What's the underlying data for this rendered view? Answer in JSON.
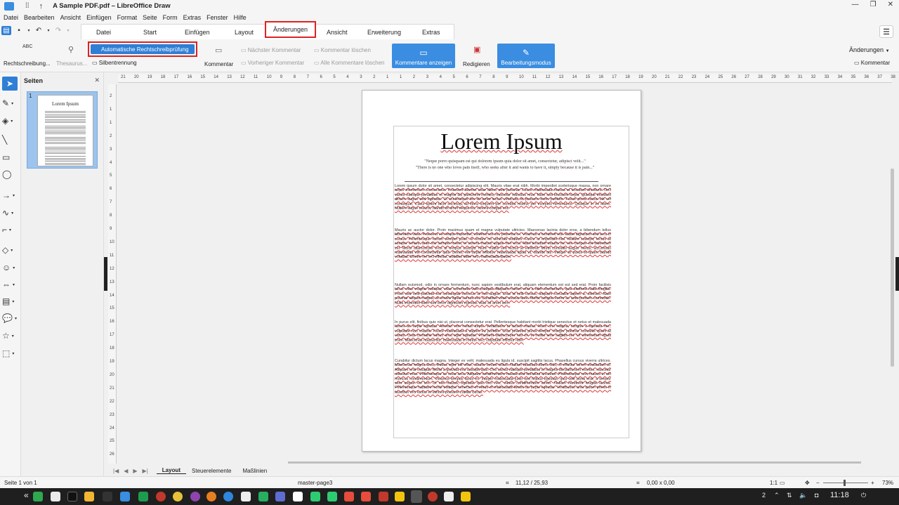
{
  "title": "A Sample PDF.pdf – LibreOffice Draw",
  "menu": [
    "Datei",
    "Bearbeiten",
    "Ansicht",
    "Einfügen",
    "Format",
    "Seite",
    "Form",
    "Extras",
    "Fenster",
    "Hilfe"
  ],
  "tabs": [
    "Datei",
    "Start",
    "Einfügen",
    "Layout",
    "Änderungen",
    "Ansicht",
    "Erweiterung",
    "Extras"
  ],
  "selected_tab": "Änderungen",
  "ribbon": {
    "spelling": "Rechtschreibung...",
    "thesaurus": "Thesaurus...",
    "auto_spell": "Automatische Rechtschreibprüfung",
    "hyphenation": "Silbentrennung",
    "comment": "Kommentar",
    "next_comment": "Nächster Kommentar",
    "prev_comment": "Vorheriger Kommentar",
    "delete_comment": "Kommentar löschen",
    "delete_all_comments": "Alle Kommentare löschen",
    "show_comments": "Kommentare anzeigen",
    "redact": "Redigieren",
    "edit_mode": "Bearbeitungsmodus",
    "changes_dropdown": "Änderungen",
    "right_comment": "Kommentar"
  },
  "pages_pane": {
    "title": "Seiten",
    "thumb_number": "1",
    "thumb_title": "Lorem Ipsum"
  },
  "ruler_h": [
    "21",
    "20",
    "19",
    "18",
    "17",
    "16",
    "15",
    "14",
    "13",
    "12",
    "11",
    "10",
    "9",
    "8",
    "7",
    "6",
    "5",
    "4",
    "3",
    "2",
    "1",
    "1",
    "2",
    "3",
    "4",
    "5",
    "6",
    "7",
    "8",
    "9",
    "10",
    "11",
    "12",
    "13",
    "14",
    "15",
    "16",
    "17",
    "18",
    "19",
    "20",
    "21",
    "22",
    "23",
    "24",
    "25",
    "26",
    "27",
    "28",
    "29",
    "30",
    "31",
    "32",
    "33",
    "34",
    "35",
    "36",
    "37",
    "38"
  ],
  "ruler_v": [
    "2",
    "1",
    "1",
    "2",
    "3",
    "4",
    "5",
    "6",
    "7",
    "8",
    "9",
    "10",
    "11",
    "12",
    "13",
    "14",
    "15",
    "16",
    "17",
    "18",
    "19",
    "20",
    "21",
    "22",
    "23",
    "24",
    "25",
    "26"
  ],
  "document": {
    "title": "Lorem Ipsum",
    "quote1": "\"Neque porro quisquam est qui dolorem ipsum quia dolor sit amet, consectetur, adipisci velit...\"",
    "quote2": "\"There is no one who loves pain itself, who seeks after it and wants to have it, simply because it is pain...\"",
    "paragraphs": [
      "Lorem ipsum dolor sit amet, consectetur adipiscing elit. Mauris vitae erat nibh. Morbi imperdiet scelerisque massa, non ornare turpis elementum consectetur. Praesent laoreet vitae libero sed pulvinar. Fusce malesuada massa et tincidunt tincidunt. Orci varius natoque penatibus et magnis dis parturient montes, nascetur ridiculus mus. Nam sed tincidunt turpis. Quisque tincidunt dictum augue sed egestas. Ut scelerisque leo sit amet lectus vehicula, et posuere enim porttitor. Fusce porta varius elit vel consequat. Class aptent taciti sociosqu ad litora torquent per conubia nostra, per inceptos himenaeos. Quisque in ex libero. Nullam augue mauris, blandit sit amet neque eu, viverra congue est.",
      "Mauris ac auctor dolor. Proin maximus quam et magna vulputate ultricies. Maecenas lacinia dolor eros, a bibendum tellus bibendum vitae. Praesent vel neque imperdiet, eleifend est vel, pharetra ex. Vivamus a hendrerit nisl. Etiam dignissim sed arcu in cursus. Pellentesque rutrum semper justo, ut ornare mi vehicula sodales. Fusce ut imperdiet nisl. Nullam suscipit, lectus at semper ornare, ante nisl semper lorem, in viverra mauris augue non eros. Nam tincidunt mauris mi, nec congue est bibendum vel. Morbi ullamcorper eros at tempus suscipit. Nunc mattis sed lectus at eleifend. Morbi convallis augue metus, accumsan malesuada elit consectetur quis. Donec vel turpis efficitur, malesuada ligula ut, blandit dui. Integer at purus et quam blandit volutpat. Donec vel orci efficitur, sodales diam nec, malesuada ipsum.",
      "Nullam euismod, odio in ornare fermentum, nunc sapien vestibulum erat, aliquam elementum est est sed erat. Proin facilisis lacus vitae magna volutpat, vitae commodo velit volutpat. Aliquam rutrum erat a nibh elementum, quis eleifend nulla fringilla. Proin sed velit pulvinar est consequat rhoncus ut non augue. Cras id velit cursus, aliquam convallis sapien a, ultricies. Nam pulvinar aliquet magna, at ornare ligula cursus vel. Curabitur vitae cursus ante. Morbi congue lorem ac ante pretium commodo. Nulla imperdiet diam sed tortor dignissim egestas vitae sit amet sem.",
      "In purus elit, finibus quis nisi ut, placerat consectetur erat. Pellentesque habitant morbi tristique senectus et netus et malesuada fames ac turpis egestas. Aenean non metus turpis. Vestibulum at iaculis massa. Nunc orci magna, congue a egestas nec, vulputate non mauris. Fusce malesuada a sapien eu porttitor. Cras pharetra purus tempor. Integer pulvinar convallis quam at varius. Cras convallis varius arcu eget egestas. Praesent ullamcorper nisl ex, et mollis ante sagittis vel. Ut elementum ligula enim. Maecenas massa dui, malesuada in metus nec, vulputate efficitur nibh.",
      "Curabitur dictum lacus magna. Integer ex velit, malesuada eu ligula id, suscipit sagittis lacus. Phasellus cursus viverra ultrices. Maecenas magna arcu, finibus eget elit vitae, iaculis ornare tellus. Nullam faucibus libero felis, in efficitur lorem vestibulum id. Aliquam erat volutpat. Morbi a gravida orci suscipit quis. Orci varius natoque penatibus et magnis dis parturient montes, nascetur ridiculus mus. Pellentesque ac risus arcu. Aliquam condimentum massa sed tincidunt tincidunt. Pellentesque non mauris in elit rhoncus condimentum. Vivamus tempus lacus ex. Integer malesuada justo sed finibus egestas, quis velit porta erat, a tempor sem augue vel leo. Ut nisi massa, egestas quis orci nec, varius condimentum lorem. Nullam hendrerit feugiat lacinia. Pellentesque habitant morbi tristique senectus et netus et malesuada fames ac turpis egestas. Vestibulum ante ipsum primis in faucibus orci luctus et ultrices posuere cubilia Curae."
    ]
  },
  "bottom_tabs": [
    "Layout",
    "Steuerelemente",
    "Maßlinien"
  ],
  "status": {
    "page": "Seite 1 von 1",
    "master": "master-page3",
    "position": "11,12 / 25,93",
    "size": "0,00 x 0,00",
    "scale": "1:1",
    "zoom": "73%"
  },
  "tray": {
    "num": "2",
    "clock": "11:18"
  },
  "colors": {
    "accent": "#2f7fd6",
    "highlight": "#d22222",
    "taskbar": "#1f1f1f"
  }
}
